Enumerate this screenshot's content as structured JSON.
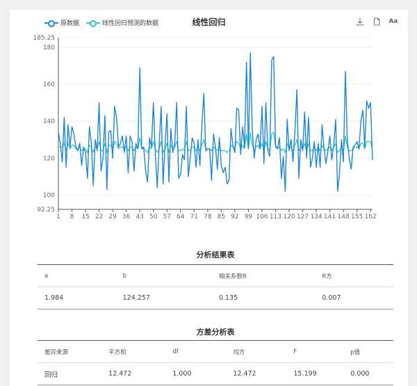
{
  "legend": [
    {
      "label": "原数据",
      "color": "#1f86d6"
    },
    {
      "label": "线性回归预测的数据",
      "color": "#2dc9c4"
    }
  ],
  "toolbox": {
    "download_icon": "download-icon",
    "data_view_icon": "document-icon",
    "font_label": "Aa"
  },
  "chart_data": {
    "type": "line",
    "title": "线性回归",
    "x_start": 1,
    "x_end": 163,
    "xtick_labels": [
      "1",
      "8",
      "15",
      "22",
      "29",
      "36",
      "43",
      "50",
      "57",
      "64",
      "71",
      "78",
      "85",
      "92",
      "99",
      "106",
      "113",
      "120",
      "127",
      "134",
      "141",
      "148",
      "155",
      "162"
    ],
    "ylim": [
      92.25,
      185.25
    ],
    "ytick_labels": [
      "185.25",
      "180",
      "160",
      "140",
      "120",
      "100",
      "92.25"
    ],
    "series": [
      {
        "name": "原数据",
        "color": "#1f86d6",
        "values": [
          134,
          128,
          118,
          142,
          115,
          138,
          126,
          137,
          133,
          126,
          124,
          128,
          116,
          126,
          123,
          109,
          137,
          128,
          105,
          130,
          124,
          150,
          113,
          120,
          143,
          103,
          134,
          135,
          120,
          148,
          142,
          126,
          128,
          132,
          123,
          132,
          112,
          132,
          129,
          113,
          128,
          125,
          169,
          125,
          126,
          113,
          107,
          131,
          126,
          150,
          122,
          104,
          127,
          148,
          106,
          127,
          144,
          107,
          136,
          123,
          128,
          150,
          109,
          111,
          122,
          119,
          148,
          110,
          120,
          131,
          128,
          115,
          130,
          116,
          138,
          155,
          124,
          125,
          125,
          108,
          133,
          126,
          114,
          131,
          116,
          112,
          115,
          106,
          108,
          136,
          127,
          123,
          147,
          146,
          122,
          137,
          126,
          172,
          125,
          177,
          135,
          120,
          130,
          133,
          125,
          148,
          117,
          150,
          124,
          121,
          173,
          175,
          127,
          125,
          131,
          109,
          121,
          102,
          141,
          124,
          130,
          118,
          135,
          157,
          109,
          130,
          124,
          145,
          120,
          142,
          115,
          120,
          129,
          115,
          128,
          115,
          138,
          125,
          117,
          124,
          132,
          119,
          127,
          141,
          102,
          112,
          130,
          118,
          167,
          130,
          120,
          114,
          126,
          127,
          129,
          125,
          140,
          146,
          126,
          151,
          147,
          150,
          119
        ]
      },
      {
        "name": "线性回归预测的数据",
        "color": "#2dc9c4",
        "values": [
          126,
          126,
          126,
          128,
          124,
          128,
          125,
          127,
          127,
          125,
          125,
          126,
          124,
          125,
          125,
          123,
          127,
          126,
          123,
          126,
          125,
          129,
          124,
          124,
          128,
          123,
          127,
          127,
          124,
          129,
          128,
          125,
          126,
          126,
          125,
          126,
          124,
          126,
          126,
          124,
          126,
          125,
          131,
          125,
          125,
          124,
          123,
          126,
          125,
          129,
          125,
          123,
          125,
          129,
          123,
          125,
          128,
          123,
          127,
          125,
          126,
          129,
          124,
          124,
          125,
          124,
          129,
          124,
          124,
          126,
          126,
          124,
          126,
          124,
          127,
          130,
          125,
          125,
          125,
          124,
          126,
          125,
          124,
          126,
          124,
          124,
          124,
          123,
          124,
          127,
          126,
          125,
          129,
          128,
          125,
          127,
          125,
          133,
          125,
          134,
          127,
          124,
          126,
          127,
          125,
          128,
          124,
          129,
          125,
          124,
          133,
          134,
          126,
          125,
          126,
          124,
          125,
          123,
          128,
          125,
          126,
          124,
          127,
          130,
          124,
          126,
          125,
          128,
          124,
          128,
          124,
          124,
          126,
          124,
          126,
          124,
          127,
          125,
          124,
          125,
          126,
          124,
          126,
          128,
          123,
          124,
          126,
          124,
          132,
          126,
          124,
          124,
          125,
          126,
          126,
          125,
          128,
          128,
          125,
          129,
          129,
          129,
          124
        ]
      }
    ]
  },
  "analysis_table": {
    "title": "分析结果表",
    "headers": [
      "a",
      "b",
      "相关系数R",
      "R方"
    ],
    "row": [
      "1.984",
      "124.257",
      "0.135",
      "0.007"
    ]
  },
  "anova_table": {
    "title": "方差分析表",
    "headers": [
      "差异来源",
      "平方和",
      "df",
      "均方",
      "F",
      "p值"
    ],
    "row": [
      "回归",
      "12.472",
      "1.000",
      "12.472",
      "15.199",
      "0.000"
    ]
  }
}
